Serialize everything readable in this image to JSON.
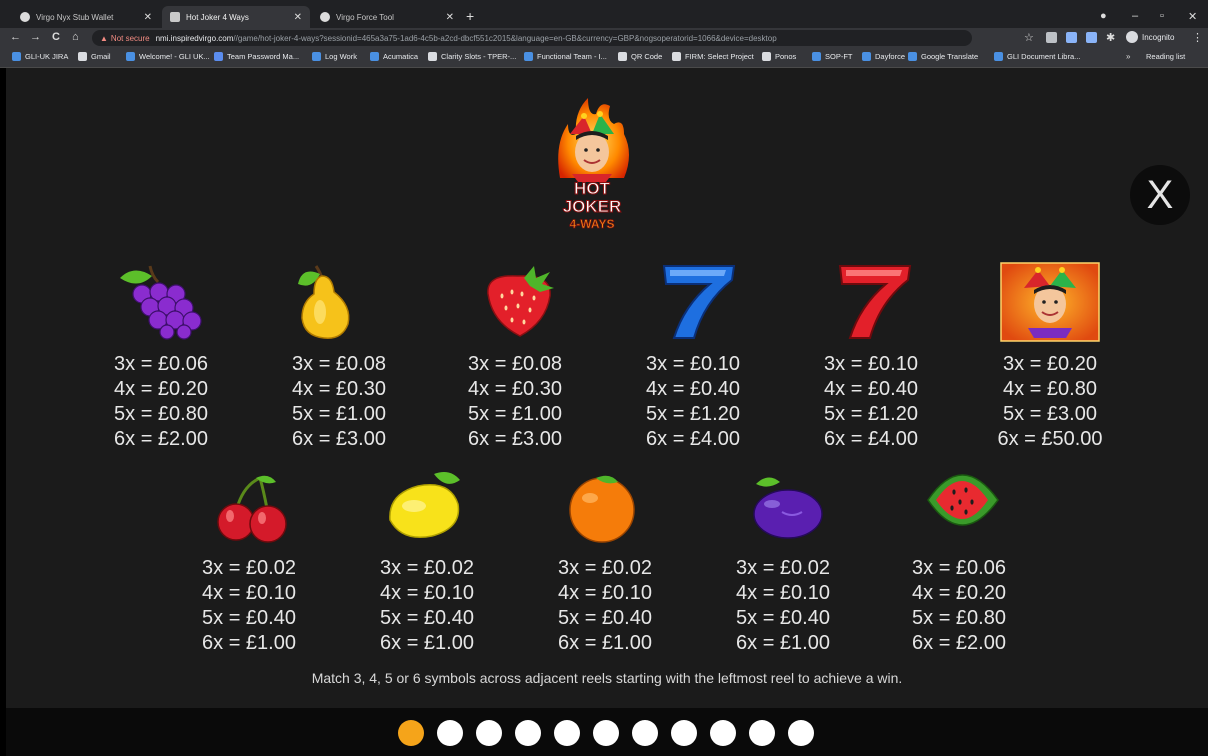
{
  "browser": {
    "tabs": [
      {
        "title": "Virgo Nyx Stub Wallet",
        "active": false
      },
      {
        "title": "Hot Joker 4 Ways",
        "active": true
      },
      {
        "title": "Virgo Force Tool",
        "active": false
      }
    ],
    "new_tab": "+",
    "window_controls": {
      "minimize": "–",
      "restore": "▫",
      "close": "✕"
    },
    "nav": {
      "back": "←",
      "forward": "→",
      "reload": "C",
      "home": "⌂"
    },
    "address": {
      "security_label": "Not secure",
      "host": "nmi.inspiredvirgo.com",
      "path": "//game/hot-joker-4-ways?sessionid=465a3a75-1ad6-4c5b-a2cd-dbcf551c2015&language=en-GB&currency=GBP&nogsoperatorid=1066&device=desktop"
    },
    "profile": "Incognito",
    "menu": "⋮",
    "bookmarks": [
      {
        "label": "GLI-UK JIRA",
        "color": "#4a90e2"
      },
      {
        "label": "Gmail",
        "color": "#dadce0"
      },
      {
        "label": "Welcome! - GLI UK...",
        "color": "#4a90e2"
      },
      {
        "label": "Team Password Ma...",
        "color": "#5b8def"
      },
      {
        "label": "Log Work",
        "color": "#4a90e2"
      },
      {
        "label": "Acumatica",
        "color": "#4a90e2"
      },
      {
        "label": "Clarity Slots - TPER-...",
        "color": "#dadce0"
      },
      {
        "label": "Functional Team - I...",
        "color": "#4a90e2"
      },
      {
        "label": "QR Code",
        "color": "#dadce0"
      },
      {
        "label": "FIRM: Select Project",
        "color": "#dadce0"
      },
      {
        "label": "Ponos",
        "color": "#dadce0"
      },
      {
        "label": "SOP-FT",
        "color": "#4a90e2"
      },
      {
        "label": "Dayforce",
        "color": "#4a90e2"
      },
      {
        "label": "Google Translate",
        "color": "#4a90e2"
      },
      {
        "label": "GLI Document Libra...",
        "color": "#4a90e2"
      }
    ],
    "bookmarks_more": "»",
    "reading_list": "Reading list"
  },
  "game": {
    "logo": {
      "line1": "HOT",
      "line2": "JOKER",
      "line3": "4-WAYS"
    },
    "close_label": "X",
    "row1": [
      {
        "icon": "grapes-icon",
        "p3": "3x = £0.06",
        "p4": "4x = £0.20",
        "p5": "5x = £0.80",
        "p6": "6x = £2.00"
      },
      {
        "icon": "pear-icon",
        "p3": "3x = £0.08",
        "p4": "4x = £0.30",
        "p5": "5x = £1.00",
        "p6": "6x = £3.00"
      },
      {
        "icon": "strawberry-icon",
        "p3": "3x = £0.08",
        "p4": "4x = £0.30",
        "p5": "5x = £1.00",
        "p6": "6x = £3.00"
      },
      {
        "icon": "blue-seven-icon",
        "p3": "3x = £0.10",
        "p4": "4x = £0.40",
        "p5": "5x = £1.20",
        "p6": "6x = £4.00"
      },
      {
        "icon": "red-seven-icon",
        "p3": "3x = £0.10",
        "p4": "4x = £0.40",
        "p5": "5x = £1.20",
        "p6": "6x = £4.00"
      },
      {
        "icon": "joker-icon",
        "p3": "3x = £0.20",
        "p4": "4x = £0.80",
        "p5": "5x = £3.00",
        "p6": "6x = £50.00"
      }
    ],
    "row2": [
      {
        "icon": "cherries-icon",
        "p3": "3x = £0.02",
        "p4": "4x = £0.10",
        "p5": "5x = £0.40",
        "p6": "6x = £1.00"
      },
      {
        "icon": "lemon-icon",
        "p3": "3x = £0.02",
        "p4": "4x = £0.10",
        "p5": "5x = £0.40",
        "p6": "6x = £1.00"
      },
      {
        "icon": "orange-icon",
        "p3": "3x = £0.02",
        "p4": "4x = £0.10",
        "p5": "5x = £0.40",
        "p6": "6x = £1.00"
      },
      {
        "icon": "plum-icon",
        "p3": "3x = £0.02",
        "p4": "4x = £0.10",
        "p5": "5x = £0.40",
        "p6": "6x = £1.00"
      },
      {
        "icon": "watermelon-icon",
        "p3": "3x = £0.06",
        "p4": "4x = £0.20",
        "p5": "5x = £0.80",
        "p6": "6x = £2.00"
      }
    ],
    "rule_text": "Match 3, 4, 5 or 6 symbols across adjacent reels starting with the leftmost reel to achieve a win.",
    "pagination": {
      "total": 11,
      "current": 1
    },
    "colors": {
      "active_dot": "#f5a41a",
      "inactive_dot": "#ffffff",
      "background": "#1b1b1b"
    }
  }
}
